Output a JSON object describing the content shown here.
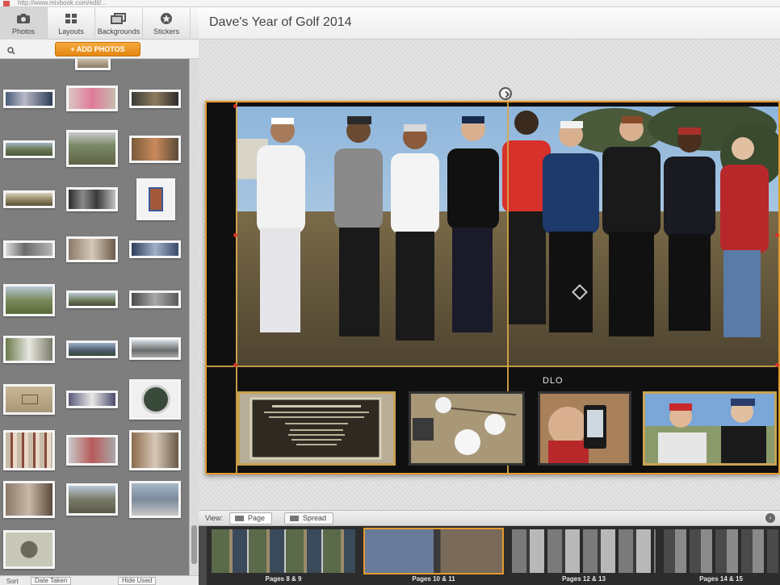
{
  "browser": {
    "url": "http://www.mixbook.com/edit/..."
  },
  "tool_tabs": [
    {
      "label": "Photos",
      "icon": "camera-icon",
      "active": true
    },
    {
      "label": "Layouts",
      "icon": "layouts-grid-icon",
      "active": false
    },
    {
      "label": "Backgrounds",
      "icon": "backgrounds-icon",
      "active": false
    },
    {
      "label": "Stickers",
      "icon": "star-sticker-icon",
      "active": false
    }
  ],
  "project": {
    "title": "Dave's Year of Golf 2014"
  },
  "library": {
    "add_photos_label": "+ ADD PHOTOS",
    "sort_label": "Sort",
    "sort_value": "Date Taken",
    "hide_used_label": "Hide Used"
  },
  "spread": {
    "caption": "DLO"
  },
  "view_bar": {
    "label": "View:",
    "page_label": "Page",
    "spread_label": "Spread",
    "active_view": "Page"
  },
  "page_strip": [
    {
      "label": "Pages 8 & 9",
      "active": false
    },
    {
      "label": "Pages 10 & 11",
      "active": true
    },
    {
      "label": "Pages 12 & 13",
      "active": false
    },
    {
      "label": "Pages 14 & 15",
      "active": false
    }
  ],
  "colors": {
    "accent": "#e39a2c",
    "library_bg": "#7e7e7e",
    "spread_bg": "#101010"
  }
}
